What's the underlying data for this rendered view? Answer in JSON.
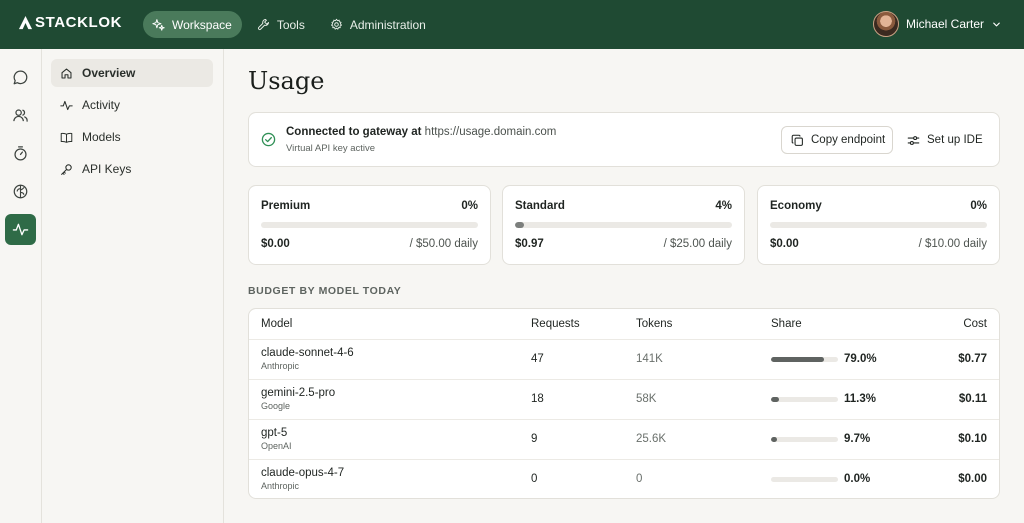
{
  "brand": {
    "name": "STACKLOK"
  },
  "nav": [
    {
      "label": "Workspace",
      "icon": "sparkles-icon",
      "active": true
    },
    {
      "label": "Tools",
      "icon": "wrench-icon",
      "active": false
    },
    {
      "label": "Administration",
      "icon": "gear-icon",
      "active": false
    }
  ],
  "user": {
    "name": "Michael Carter"
  },
  "rail": [
    {
      "icon": "chat-icon",
      "active": false
    },
    {
      "icon": "users-icon",
      "active": false
    },
    {
      "icon": "timer-icon",
      "active": false
    },
    {
      "icon": "brain-icon",
      "active": false
    },
    {
      "icon": "activity-icon",
      "active": true
    }
  ],
  "subnav": [
    {
      "label": "Overview",
      "icon": "home-icon",
      "active": true
    },
    {
      "label": "Activity",
      "icon": "activity-icon",
      "active": false
    },
    {
      "label": "Models",
      "icon": "book-icon",
      "active": false
    },
    {
      "label": "API Keys",
      "icon": "key-icon",
      "active": false
    }
  ],
  "page": {
    "title": "Usage"
  },
  "gateway": {
    "title": "Connected to gateway at",
    "url": "https://usage.domain.com",
    "subtitle": "Virtual API key active",
    "copy_label": "Copy endpoint",
    "setup_label": "Set up IDE"
  },
  "tiers": [
    {
      "name": "Premium",
      "percent_label": "0%",
      "fill": 0,
      "spent": "$0.00",
      "limit": "/ $50.00 daily"
    },
    {
      "name": "Standard",
      "percent_label": "4%",
      "fill": 0.04,
      "spent": "$0.97",
      "limit": "/ $25.00 daily"
    },
    {
      "name": "Economy",
      "percent_label": "0%",
      "fill": 0,
      "spent": "$0.00",
      "limit": "/ $10.00 daily"
    }
  ],
  "budget": {
    "section_title": "BUDGET BY MODEL TODAY",
    "columns": {
      "model": "Model",
      "requests": "Requests",
      "tokens": "Tokens",
      "share": "Share",
      "cost": "Cost"
    },
    "rows": [
      {
        "model": "claude-sonnet-4-6",
        "provider": "Anthropic",
        "requests": "47",
        "tokens": "141K",
        "share": 0.79,
        "share_label": "79.0%",
        "cost": "$0.77"
      },
      {
        "model": "gemini-2.5-pro",
        "provider": "Google",
        "requests": "18",
        "tokens": "58K",
        "share": 0.113,
        "share_label": "11.3%",
        "cost": "$0.11"
      },
      {
        "model": "gpt-5",
        "provider": "OpenAI",
        "requests": "9",
        "tokens": "25.6K",
        "share": 0.097,
        "share_label": "9.7%",
        "cost": "$0.10"
      },
      {
        "model": "claude-opus-4-7",
        "provider": "Anthropic",
        "requests": "0",
        "tokens": "0",
        "share": 0,
        "share_label": "0.0%",
        "cost": "$0.00"
      }
    ]
  },
  "colors": {
    "header": "#1f4a33",
    "accent": "#2f6b47",
    "check": "#2f8f55"
  }
}
